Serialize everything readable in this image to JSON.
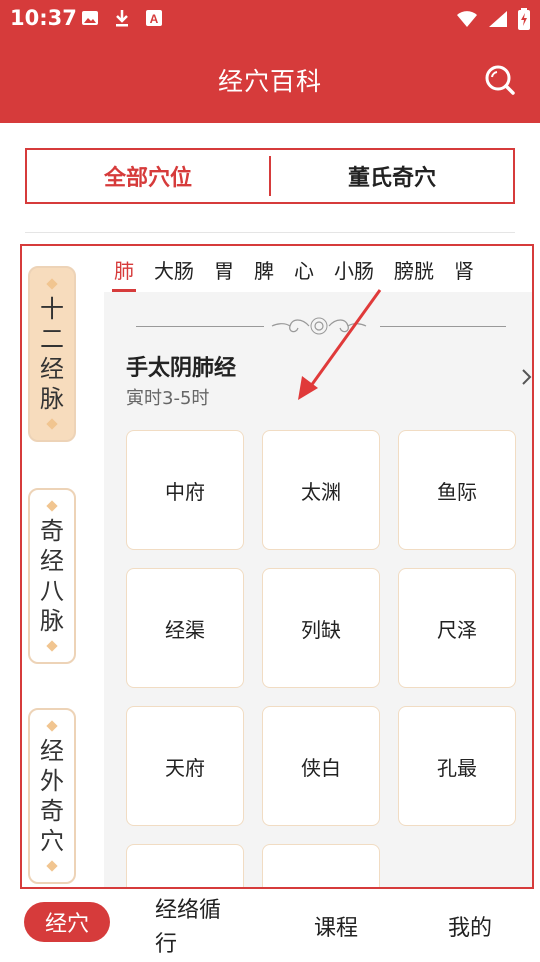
{
  "status_bar": {
    "time": "10:37",
    "left_icons": [
      "image-icon",
      "download-icon",
      "a-badge-icon"
    ],
    "right_icons": [
      "wifi-icon",
      "signal-icon",
      "battery-charging-icon"
    ]
  },
  "header": {
    "title": "经穴百科",
    "search_icon": "search-icon"
  },
  "segment_tabs": {
    "all_points": "全部穴位",
    "dong_points": "董氏奇穴",
    "active_index": 0
  },
  "side_categories": [
    {
      "label": [
        "十",
        "二",
        "经",
        "脉"
      ],
      "active": true
    },
    {
      "label": [
        "奇",
        "经",
        "八",
        "脉"
      ],
      "active": false
    },
    {
      "label": [
        "经",
        "外",
        "奇",
        "穴"
      ],
      "active": false
    }
  ],
  "meridian_tabs": [
    "肺",
    "大肠",
    "胃",
    "脾",
    "心",
    "小肠",
    "膀胱",
    "肾"
  ],
  "meridian": {
    "name": "手太阴肺经",
    "time": "寅时3-5时"
  },
  "acupoints": [
    "中府",
    "太渊",
    "鱼际",
    "经渠",
    "列缺",
    "尺泽",
    "天府",
    "侠白",
    "孔最",
    "",
    ""
  ],
  "bottom_nav": {
    "item1": "经穴",
    "item2_line1": "经络循",
    "item2_line2": "行",
    "item3": "课程",
    "item4": "我的"
  },
  "colors": {
    "primary": "#d63b3b",
    "tag_active": "#f7dcbd",
    "tag_border": "#edd3b7",
    "panel_bg": "#f4f4f4"
  }
}
